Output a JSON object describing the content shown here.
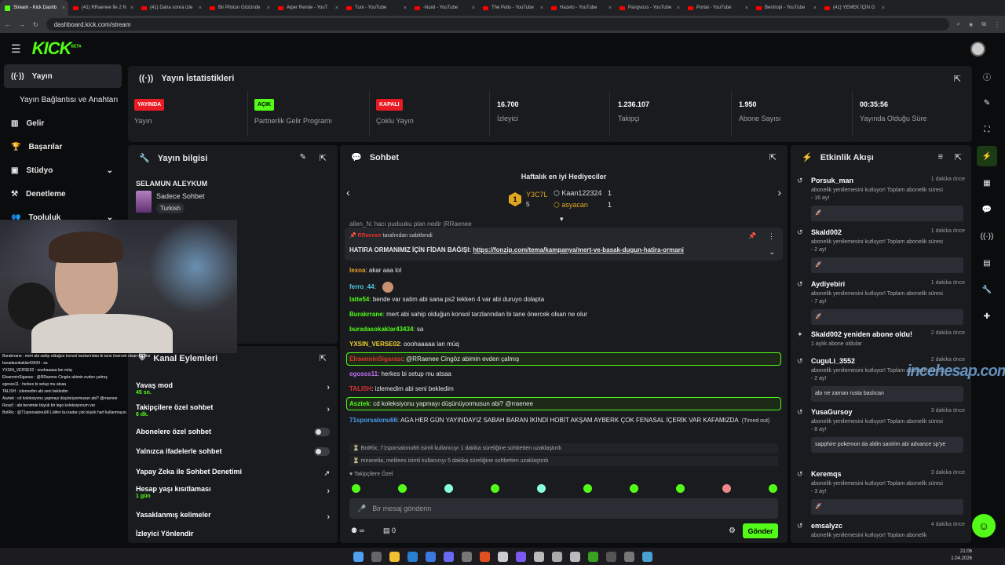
{
  "browser": {
    "tabs": [
      "Stream - Kick Dashb",
      "(41) RRaenee İle 2 N",
      "(41) Daha sonra izle",
      "Bir Pilotun Gözünde",
      "Alper Rende - YouT",
      "Tuni - YouTube",
      "-Nuxil - YouTube",
      "The Polis - YouTube",
      "Hazelo - YouTube",
      "Pangvoss - YouTube",
      "Portal - YouTube",
      "Bentropi - YouTube",
      "(41) YEMEK İÇİN G"
    ],
    "url": "dashboard.kick.com/stream"
  },
  "header": {
    "logo": "KICK",
    "logo_sup": "BETA"
  },
  "sidebar": {
    "items": [
      {
        "label": "Yayın",
        "icon": "broadcast-icon"
      },
      {
        "label": "Yayın Bağlantısı ve Anahtarı",
        "icon": ""
      },
      {
        "label": "Gelir",
        "icon": "chart-icon"
      },
      {
        "label": "Başarılar",
        "icon": "trophy-icon"
      },
      {
        "label": "Stüdyo",
        "icon": "studio-icon"
      },
      {
        "label": "Denetleme",
        "icon": "hammer-icon"
      },
      {
        "label": "Topluluk",
        "icon": "community-icon"
      }
    ]
  },
  "stats": {
    "title": "Yayın İstatistikleri",
    "items": [
      {
        "badge": "YAYINDA",
        "label": "Yayın",
        "color": "#e81b24"
      },
      {
        "badge": "AÇIK",
        "label": "Partnerlik Gelir Programı",
        "color": "#53fc18"
      },
      {
        "badge": "KAPALI",
        "label": "Çoklu Yayın",
        "color": "#e81b24"
      },
      {
        "value": "16.700",
        "label": "İzleyici"
      },
      {
        "value": "1.236.107",
        "label": "Takipçi"
      },
      {
        "value": "1.950",
        "label": "Abone Sayısı"
      },
      {
        "value": "00:35:56",
        "label": "Yayında Olduğu Süre"
      }
    ]
  },
  "info": {
    "title": "Yayın bilgisi",
    "stream_title": "SELAMUN ALEYKUM",
    "category": "Sadece Sohbet",
    "tag": "Turkish"
  },
  "actions": {
    "title": "Kanal Eylemleri",
    "rows": [
      {
        "label": "Yavaş mod",
        "sub": "45 sn."
      },
      {
        "label": "Takipçilere özel sohbet",
        "sub": "6 dk."
      },
      {
        "label": "Abonelere özel sohbet"
      },
      {
        "label": "Yalnızca ifadelerle sohbet"
      },
      {
        "label": "Yapay Zeka ile Sohbet Denetimi"
      },
      {
        "label": "Hesap yaşı kısıtlaması",
        "sub": "1 gün"
      },
      {
        "label": "Yasaklanmış kelimeler"
      },
      {
        "label": "İzleyici Yönlendir"
      }
    ]
  },
  "chat": {
    "title": "Sohbet",
    "gifters_title": "Haftalık en iyi Hediyeciler",
    "gifters": [
      {
        "name": "Y3C7L",
        "count": "5"
      },
      {
        "name": "Kaan122324",
        "count": "1"
      },
      {
        "name": "asyacan",
        "count": "1"
      }
    ],
    "pinned_by": "tarafından sabitlendi",
    "pinned_user": "RRaenee",
    "pinned_text": "HATIRA ORMANIMIZ İÇİN FİDAN BAĞIŞI:",
    "pinned_link": "https://fonzip.com/tema/kampanya/mert-ve-basak-dugun-hatira-ormani",
    "partial_top": "allen_N: hacı puduuku plan nedir (RRaenee",
    "messages": [
      {
        "user": "lexoa",
        "color": "#f0a030",
        "text": "akar aaa lol"
      },
      {
        "user": "ferro_44",
        "color": "#4ec9e0",
        "text": ""
      },
      {
        "user": "latte54",
        "color": "#53fc18",
        "text": "bende var satim abi sana ps2 tekken 4 var abi duruyo dolapta"
      },
      {
        "user": "Burakrrane",
        "color": "#53fc18",
        "text": "mert abi sahip olduğun konsol tarzlarından bi tane önercek olsan ne olur"
      },
      {
        "user": "buradasokaklar43434",
        "color": "#53fc18",
        "text": "sa"
      },
      {
        "user": "YXSIN_VERSE02",
        "color": "#f0d030",
        "text": "ooohaaaaa lan müq"
      },
      {
        "user": "ElraenninSigarası",
        "color": "#e03030",
        "text": "@RRaenee Cingöz abimin evden çalmış"
      },
      {
        "user": "egosss11",
        "color": "#c070f0",
        "text": "herkes bi setup mu atsaa"
      },
      {
        "user": "TALISH",
        "color": "#e03030",
        "text": "izlemedim abi seni bekledim"
      },
      {
        "user": "Asztek",
        "color": "#53fc18",
        "text": "cd koleksiyonu yapmayı düşünüyormusun abi? @rraenee"
      },
      {
        "user": "71sporsalonu66",
        "color": "#4e9cf0",
        "text": "AGA HER GÜN YAYINDAYIZ SABAH BARAN İKİNDİ HOBİT AKŞAM AYBERK ÇOK FENASAL İÇERİK VAR KAFAMIZDA",
        "suffix": "(Timed out)"
      }
    ],
    "system": [
      "BotRix, 71sporsalonu66 isimli kullanıcıyı 1 dakika süreliğine sohbetten uzaklaştırdı",
      "miranelia, melilees isimli kullanıcıyı 5 dakika süreliğine sohbetten uzaklaştırdı"
    ],
    "followers_label": "Takipçilere Özel",
    "input_placeholder": "Bir mesaj gönderin",
    "viewers_inf": "∞",
    "count": "0",
    "send": "Gönder"
  },
  "events": {
    "title": "Etkinlik Akışı",
    "items": [
      {
        "name": "Porsuk_man",
        "time": "1 dakika önce",
        "desc": "abonelik yenilemesini kutluyor! Toplam abonelik süresi - 16 ay!",
        "box": ""
      },
      {
        "name": "Skald002",
        "time": "1 dakika önce",
        "desc": "abonelik yenilemesini kutluyor! Toplam abonelik süresi - 2 ay!",
        "box": ""
      },
      {
        "name": "Aydiyebiri",
        "time": "1 dakika önce",
        "desc": "abonelik yenilemesini kutluyor! Toplam abonelik süresi - 7 ay!",
        "box": ""
      },
      {
        "name": "Skald002 yeniden abone oldu!",
        "time": "2 dakika önce",
        "desc": "1 aylık abone oldular",
        "box": null
      },
      {
        "name": "CuguLi_3552",
        "time": "2 dakika önce",
        "desc": "abonelik yenilemesini kutluyor! Toplam abonelik süresi - 2 ay!",
        "box": "abı ne zaman rusta baslıcan"
      },
      {
        "name": "YusaGursoy",
        "time": "3 dakika önce",
        "desc": "abonelik yenilemesini kutluyor! Toplam abonelik süresi - 8 ay!",
        "box": "sapphire pokemon da aldin sanirim abi advance sp'ye"
      },
      {
        "name": "Keremqs",
        "time": "3 dakika önce",
        "desc": "abonelik yenilemesini kutluyor! Toplam abonelik süresi - 3 ay!",
        "box": ""
      },
      {
        "name": "emsalyzc",
        "time": "4 dakika önce",
        "desc": "abonelik yenilemesini kutluyor! Toplam abonelik",
        "box": null
      }
    ]
  },
  "overlay_chat": [
    "Burakrrane : mert abi sahip olduğun konsol tarzlarından bi tane önercek olsan ne olur",
    "buradasokaklar43434 : sa",
    "YXSIN_VERSE02 : ooohaaaaa lan müq",
    "ElraenninSigarası : @RRaenee Cingöz abimin evden çalmış",
    "egosss11 : herkes bi setup mu atsaa",
    "TALISH : izlemedim abi seni bekledim",
    "Asztek : cd koleksiyonu yapmayı düşünüyormusun abi? @rraenee",
    "Rexy0 : abi benimde büyük bir lego koleksiyonum var",
    "BotRix : @71sporsalonu66 Lütfen bu kadar çok büyük harf kullanmayın."
  ],
  "watermark": "incehesap.com",
  "taskbar": {
    "time": "21:06",
    "date": "1.04.2026"
  }
}
